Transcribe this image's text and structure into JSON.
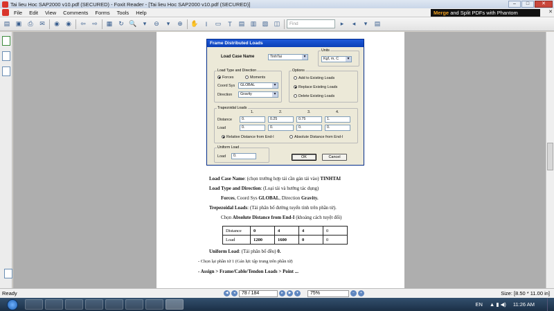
{
  "window": {
    "title": "Tai lieu Hoc SAP2000 v10.pdf (SECURED) - Foxit Reader - [Tai lieu Hoc SAP2000 v10.pdf (SECURED)]",
    "min": "–",
    "max": "□",
    "close": "✕"
  },
  "menu": {
    "items": [
      "File",
      "Edit",
      "View",
      "Comments",
      "Forms",
      "Tools",
      "Help"
    ],
    "banner_brand": "Merge",
    "banner_text": "and Split PDFs with Phantom"
  },
  "toolbar": {
    "find_placeholder": "Find"
  },
  "dialog": {
    "title": "Frame Distributed Loads",
    "load_case_label": "Load Case Name",
    "load_case_value": "TinhTai",
    "units_label": "Units",
    "units_value": "Kgf, m, C",
    "type_dir_label": "Load Type and Direction",
    "forces": "Forces",
    "moments": "Moments",
    "coord_sys_label": "Coord Sys",
    "coord_sys_value": "GLOBAL",
    "direction_label": "Direction",
    "direction_value": "Gravity",
    "options_label": "Options",
    "opt_add": "Add to Existing Loads",
    "opt_replace": "Replace Existing Loads",
    "opt_delete": "Delete Existing Loads",
    "trap_label": "Trapezoidal Loads",
    "cols": [
      "1.",
      "2.",
      "3.",
      "4."
    ],
    "distance_label": "Distance",
    "distance_values": [
      "0.",
      "0.25",
      "0.75",
      "1."
    ],
    "load_label": "Load",
    "load_values": [
      "0.",
      "0.",
      "0.",
      "0."
    ],
    "relative": "Relative Distance from End-I",
    "absolute": "Absolute Distance from End-I",
    "uniform_label": "Uniform Load",
    "uniform_load_label": "Load",
    "uniform_value": "0.",
    "ok": "OK",
    "cancel": "Cancel"
  },
  "page": {
    "l1_b": "Load Case Name",
    "l1_t": ": (chọn trường hợp tải cần gán tải vào) ",
    "l1_b2": "TINHTAI",
    "l2_b": "Load Type and Direction",
    "l2_t": ": (Loại tải và hướng tác dụng)",
    "l3_b": "Forces",
    "l3_t1": ", Coord Sys ",
    "l3_b2": "GLOBAL",
    "l3_t2": ", Direction ",
    "l3_b3": "Gravity.",
    "l4_b": "Trepezoidal Loads",
    "l4_t": ": (Tải phân bố đường tuyến tính trên phần tử).",
    "l5_t1": "Chọn ",
    "l5_b": "Absolute Distance from End-I",
    "l5_t2": " (khoảng cách tuyệt đối)",
    "table": {
      "row1": [
        "Distance",
        "0",
        "4",
        "4",
        "0"
      ],
      "row2": [
        "Load",
        "1200",
        "1600",
        "0",
        "0"
      ]
    },
    "l6_b": "Uniform Load",
    "l6_t": ": (Tải phân bố đều) ",
    "l6_b2": "0.",
    "l7": "- Chọn lại phần tử 1 (Gán lực tập trung trên phần tử)",
    "l8": "- Assign > Frame/Cable/Tendon Loads > Point ..."
  },
  "status": {
    "ready": "Ready",
    "page": "78 / 184",
    "zoom": "75%",
    "size": "Size: [8.50 * 11.00 in]"
  },
  "taskbar": {
    "lang": "EN",
    "time": "11:26 AM"
  }
}
